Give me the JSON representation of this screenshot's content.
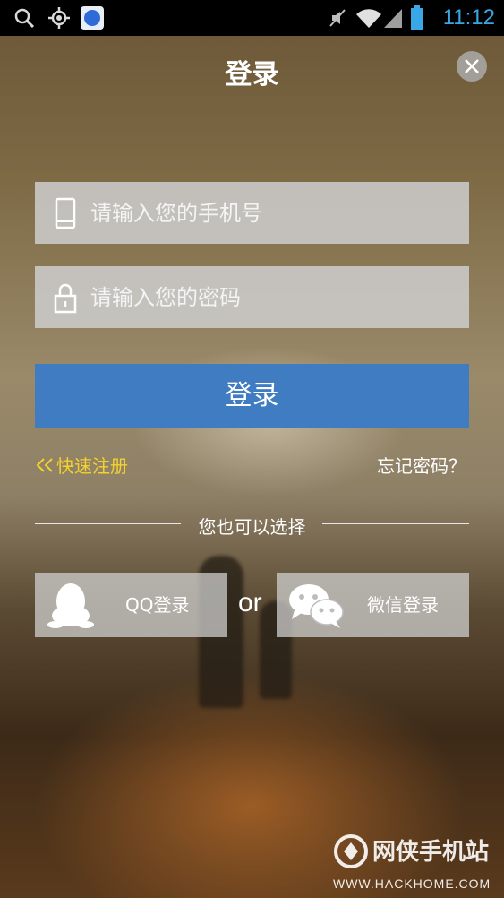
{
  "status_bar": {
    "time": "11:12",
    "icons": [
      "search-icon",
      "location-icon",
      "baidu-app-icon",
      "mute-icon",
      "wifi-icon",
      "signal-icon",
      "battery-icon"
    ]
  },
  "header": {
    "title": "登录",
    "close_icon": "close-icon"
  },
  "form": {
    "phone": {
      "placeholder": "请输入您的手机号",
      "value": "",
      "icon": "phone-icon"
    },
    "password": {
      "placeholder": "请输入您的密码",
      "value": "",
      "icon": "lock-icon"
    },
    "submit_label": "登录"
  },
  "links": {
    "register": "快速注册",
    "forgot": "忘记密码？"
  },
  "alternative": {
    "heading": "您也可以选择",
    "qq_label": "QQ登录",
    "or_label": "or",
    "wechat_label": "微信登录"
  },
  "watermark": {
    "name": "网侠手机站",
    "url": "WWW.HACKHOME.COM"
  },
  "colors": {
    "accent_blue": "#3f7cc2",
    "link_yellow": "#f2d22f",
    "time_blue": "#39a7e6"
  }
}
